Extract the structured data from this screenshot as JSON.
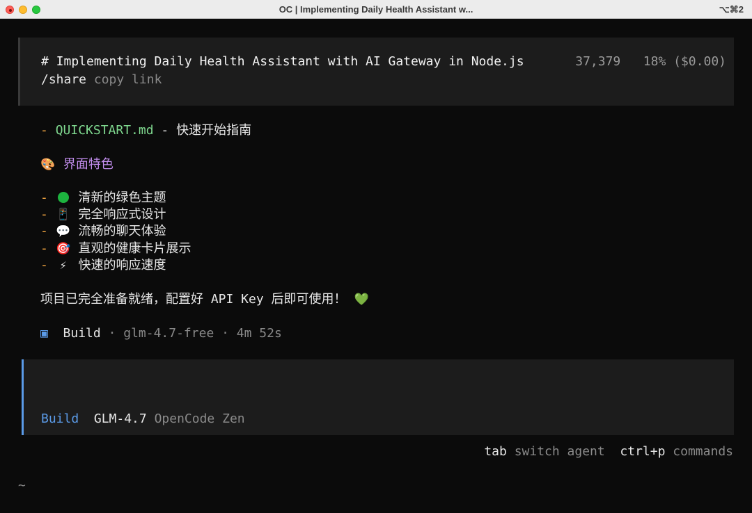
{
  "window": {
    "title": "OC | Implementing Daily Health Assistant w...",
    "shortcut": "⌥⌘2"
  },
  "header": {
    "title": "# Implementing Daily Health Assistant with AI Gateway in Node.js",
    "tokens": "37,379",
    "usage": "18% ($0.00)",
    "share_command": "/share",
    "share_label": "copy link"
  },
  "content": {
    "quickstart": {
      "dash": "-",
      "filename": "QUICKSTART.md",
      "description": "- 快速开始指南"
    },
    "section_emoji": "🎨",
    "section_title": "界面特色",
    "features": [
      {
        "icon": "green-circle-icon",
        "text": "清新的绿色主题"
      },
      {
        "icon": "📱",
        "text": "完全响应式设计"
      },
      {
        "icon": "💬",
        "text": "流畅的聊天体验"
      },
      {
        "icon": "🎯",
        "text": "直观的健康卡片展示"
      },
      {
        "icon": "⚡",
        "text": "快速的响应速度"
      }
    ],
    "ready_text": "项目已完全准备就绪，配置好 API Key 后即可使用！",
    "ready_emoji": "💚",
    "build_status": {
      "marker": "▣",
      "label": "Build",
      "model": "· glm-4.7-free · 4m 52s"
    }
  },
  "input": {
    "agent": "Build",
    "model": "GLM-4.7",
    "provider": "OpenCode Zen"
  },
  "hints": {
    "tab_key": "tab",
    "tab_label": "switch agent",
    "commands_key": "ctrl+p",
    "commands_label": "commands"
  },
  "prompt": "~",
  "colors": {
    "accent_blue": "#5b9be8",
    "dash_orange": "#f5a742",
    "filename_green": "#7fd88f",
    "section_purple": "#c48ff0"
  }
}
